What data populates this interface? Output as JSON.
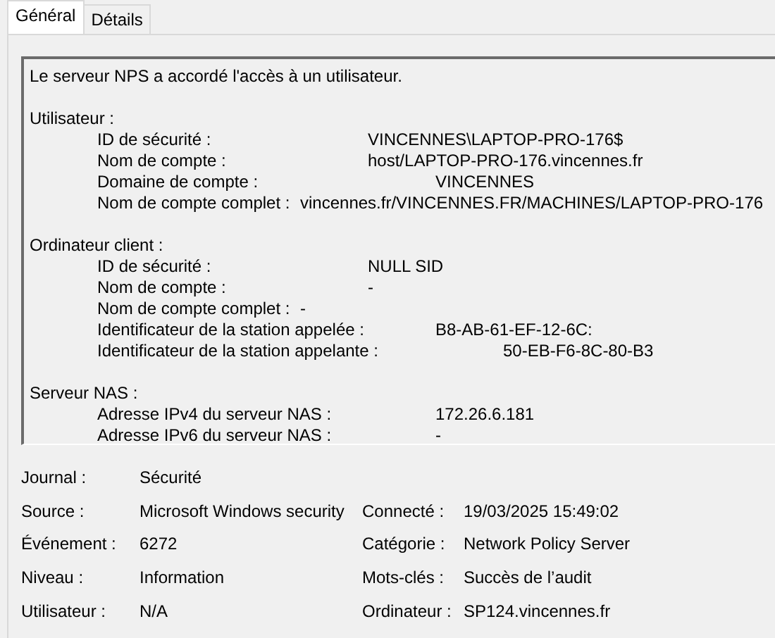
{
  "tabs": [
    {
      "label": "Général",
      "selected": true
    },
    {
      "label": "Détails",
      "selected": false
    }
  ],
  "description": {
    "message": "Le serveur NPS a accordé l'accès à un utilisateur.",
    "sections": [
      {
        "heading": "Utilisateur :",
        "lines": [
          "\tID de sécurité :\t\t\tVINCENNES\\LAPTOP-PRO-176$",
          "\tNom de compte :\t\t\thost/LAPTOP-PRO-176.vincennes.fr",
          "\tDomaine de compte :\t\t\tVINCENNES",
          "\tNom de compte complet :\tvincennes.fr/VINCENNES.FR/MACHINES/LAPTOP-PRO-176"
        ]
      },
      {
        "heading": "Ordinateur client :",
        "lines": [
          "\tID de sécurité :\t\t\tNULL SID",
          "\tNom de compte :\t\t\t-",
          "\tNom de compte complet :\t-",
          "\tIdentificateur de la station appelée :\t\tB8-AB-61-EF-12-6C:",
          "\tIdentificateur de la station appelante :\t\t50-EB-F6-8C-80-B3"
        ]
      },
      {
        "heading": "Serveur NAS :",
        "lines": [
          "\tAdresse IPv4 du serveur NAS :\t\t172.26.6.181",
          "\tAdresse IPv6 du serveur NAS :\t\t-"
        ]
      }
    ]
  },
  "properties": [
    {
      "left": {
        "label": "Journal :",
        "value": "Sécurité"
      }
    },
    {
      "left": {
        "label": "Source :",
        "value": "Microsoft Windows security"
      },
      "right": {
        "label": "Connecté :",
        "value": "19/03/2025 15:49:02"
      }
    },
    {
      "left": {
        "label": "Événement :",
        "value": "6272"
      },
      "right": {
        "label": "Catégorie :",
        "value": "Network Policy Server"
      }
    },
    {
      "left": {
        "label": "Niveau :",
        "value": "Information"
      },
      "right": {
        "label": "Mots-clés :",
        "value": "Succès de l’audit"
      }
    },
    {
      "left": {
        "label": "Utilisateur :",
        "value": "N/A"
      },
      "right": {
        "label": "Ordinateur :",
        "value": "SP124.vincennes.fr"
      }
    }
  ]
}
